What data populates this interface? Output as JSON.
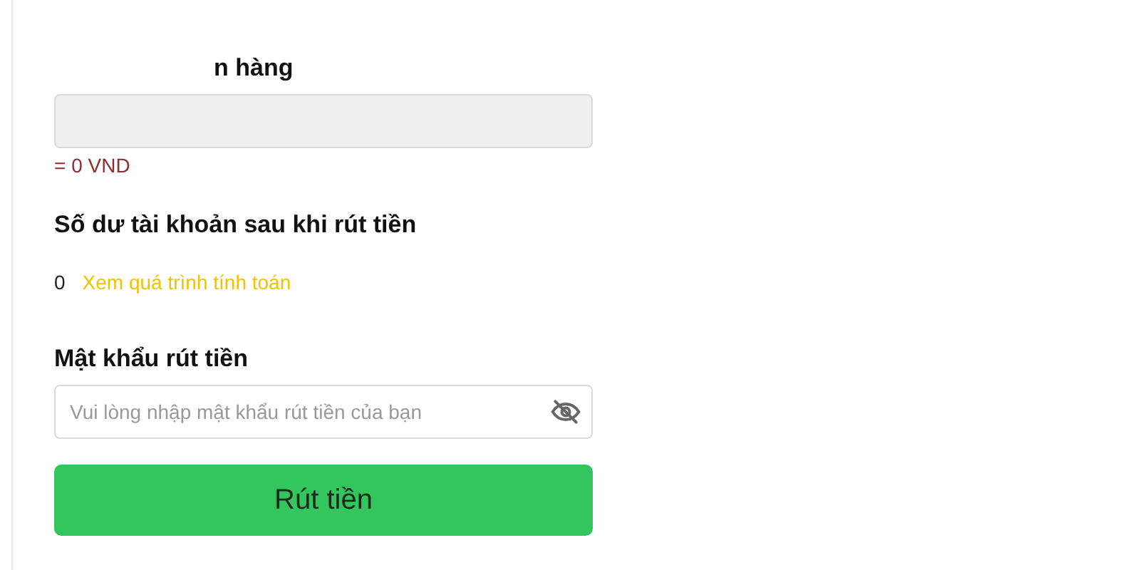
{
  "amount_field": {
    "label": "n hàng",
    "disabled": true
  },
  "converted": "= 0 VND",
  "balance": {
    "label": "Số dư tài khoản sau khi rút tiền",
    "value": "0",
    "link": "Xem quá trình tính toán"
  },
  "password": {
    "label": "Mật khẩu rút tiền",
    "placeholder": "Vui lòng nhập mật khẩu rút tiền của bạn"
  },
  "submit_button": "Rút tiền"
}
